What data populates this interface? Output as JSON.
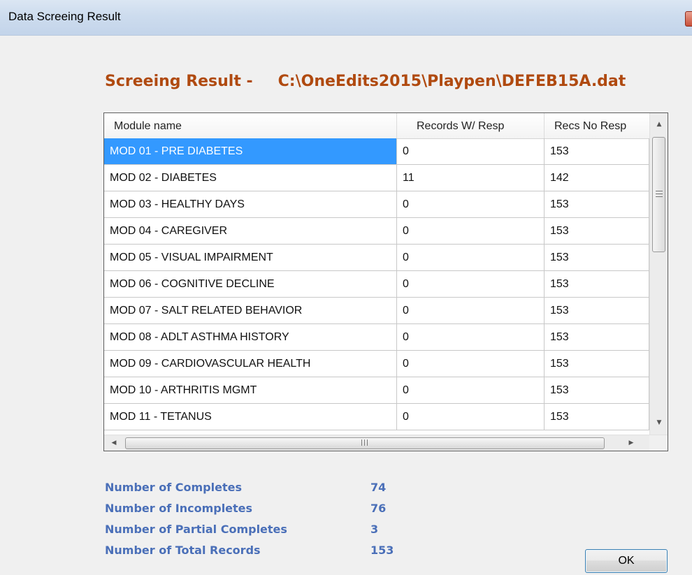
{
  "window": {
    "title": "Data Screeing Result"
  },
  "heading": {
    "label": "Screeing Result -",
    "path": "C:\\OneEdits2015\\Playpen\\DEFEB15A.dat"
  },
  "grid": {
    "columns": [
      "Module name",
      "Records W/ Resp",
      "Recs No Resp"
    ],
    "selected_row": 0,
    "rows": [
      [
        "MOD 01 - PRE DIABETES",
        "0",
        "153"
      ],
      [
        "MOD 02 - DIABETES",
        "11",
        "142"
      ],
      [
        "MOD 03 - HEALTHY DAYS",
        "0",
        "153"
      ],
      [
        "MOD 04 - CAREGIVER",
        "0",
        "153"
      ],
      [
        "MOD 05 - VISUAL IMPAIRMENT",
        "0",
        "153"
      ],
      [
        "MOD 06 - COGNITIVE DECLINE",
        "0",
        "153"
      ],
      [
        "MOD 07 - SALT RELATED BEHAVIOR",
        "0",
        "153"
      ],
      [
        "MOD 08 - ADLT ASTHMA HISTORY",
        "0",
        "153"
      ],
      [
        "MOD 09 - CARDIOVASCULAR HEALTH",
        "0",
        "153"
      ],
      [
        "MOD 10 - ARTHRITIS MGMT",
        "0",
        "153"
      ],
      [
        "MOD 11 - TETANUS",
        "0",
        "153"
      ]
    ]
  },
  "stats": [
    {
      "label": "Number of Completes",
      "value": "74"
    },
    {
      "label": "Number of Incompletes",
      "value": "76"
    },
    {
      "label": "Number of Partial Completes",
      "value": "3"
    },
    {
      "label": "Number of Total Records",
      "value": "153"
    }
  ],
  "buttons": {
    "ok_label": "OK"
  },
  "icons": {
    "close": "close-icon",
    "scroll_up": "arrow-up-icon",
    "scroll_down": "arrow-down-icon",
    "scroll_left": "arrow-left-icon",
    "scroll_right": "arrow-right-icon"
  },
  "colors": {
    "heading": "#b04a10",
    "stats": "#4a6fb8",
    "selection": "#3399ff"
  }
}
